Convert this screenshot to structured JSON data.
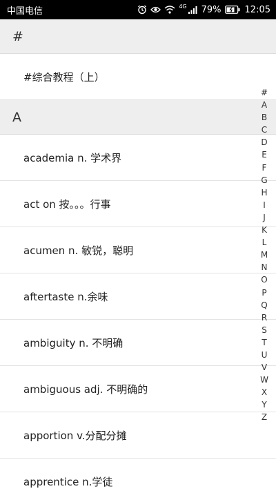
{
  "status_bar": {
    "carrier": "中国电信",
    "network": "4G",
    "battery": "79%",
    "time": "12:05",
    "icons": [
      "alarm-icon",
      "eye-icon",
      "wifi-icon",
      "signal-icon",
      "battery-icon"
    ]
  },
  "sections": [
    {
      "header": "#",
      "items": [
        {
          "label": "#综合教程（上）"
        }
      ]
    },
    {
      "header": "A",
      "items": [
        {
          "label": "academia n. 学术界"
        },
        {
          "label": "act on 按。。。行事"
        },
        {
          "label": "acumen n. 敏锐，聪明"
        },
        {
          "label": "aftertaste n.余味"
        },
        {
          "label": "ambiguity n. 不明确"
        },
        {
          "label": "ambiguous adj. 不明确的"
        },
        {
          "label": "apportion v.分配分摊"
        },
        {
          "label": "apprentice n.学徒"
        }
      ]
    }
  ],
  "index": [
    "#",
    "A",
    "B",
    "C",
    "D",
    "E",
    "F",
    "G",
    "H",
    "I",
    "J",
    "K",
    "L",
    "M",
    "N",
    "O",
    "P",
    "Q",
    "R",
    "S",
    "T",
    "U",
    "V",
    "W",
    "X",
    "Y",
    "Z"
  ]
}
